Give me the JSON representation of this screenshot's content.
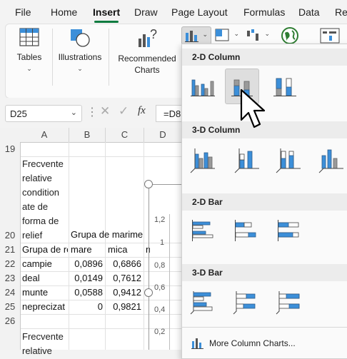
{
  "menu": {
    "tabs": [
      "File",
      "Home",
      "Insert",
      "Draw",
      "Page Layout",
      "Formulas",
      "Data",
      "Re"
    ],
    "active": "Insert"
  },
  "ribbon": {
    "tables": "Tables",
    "illustrations": "Illustrations",
    "recommended_line1": "Recommended",
    "recommended_line2": "Charts"
  },
  "formula_bar": {
    "name_box": "D25",
    "fx_label": "fx",
    "formula": "=D8"
  },
  "sheet": {
    "columns": [
      "A",
      "B",
      "C",
      "D"
    ],
    "rows": [
      "19",
      "20",
      "21",
      "22",
      "23",
      "24",
      "25",
      "26"
    ],
    "a20_lines": [
      "Frecvente",
      "relative",
      "condition",
      "ate de",
      "forma de",
      "relief"
    ],
    "b20": "Grupa de marime",
    "a21": "Grupa de re",
    "b21": "mare",
    "c21": "mica",
    "d21": "n",
    "data_rows": [
      {
        "label": "campie",
        "mare": "0,0896",
        "mica": "0,6866"
      },
      {
        "label": "deal",
        "mare": "0,0149",
        "mica": "0,7612"
      },
      {
        "label": "munte",
        "mare": "0,0588",
        "mica": "0,9412"
      },
      {
        "label": "neprecizat",
        "mare": "0",
        "mica": "0,9821"
      }
    ],
    "a27_lines": [
      "Frecvente",
      "relative"
    ]
  },
  "chart_axis": {
    "ticks": [
      "1,2",
      "1",
      "0,8",
      "0,6",
      "0,4",
      "0,2"
    ]
  },
  "dropdown": {
    "sections": [
      "2-D Column",
      "3-D Column",
      "2-D Bar",
      "3-D Bar"
    ],
    "more": "More Column Charts...",
    "colors": {
      "blue": "#3c8fd9",
      "gray": "#9a9a9a",
      "outline": "#2f5d8a"
    }
  }
}
